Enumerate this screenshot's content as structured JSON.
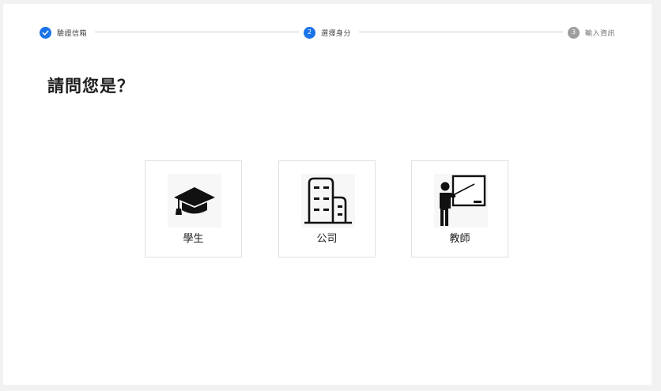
{
  "stepper": {
    "steps": [
      {
        "number": "",
        "label": "驗證信箱",
        "state": "done"
      },
      {
        "number": "2",
        "label": "選擇身分",
        "state": "active"
      },
      {
        "number": "3",
        "label": "輸入資訊",
        "state": "pending"
      }
    ]
  },
  "main": {
    "title": "請問您是？",
    "options": [
      {
        "label": "學生",
        "icon": "graduation-cap-icon"
      },
      {
        "label": "公司",
        "icon": "building-icon"
      },
      {
        "label": "教師",
        "icon": "teacher-icon"
      }
    ]
  },
  "colors": {
    "accent": "#1a73e8",
    "pending": "#9e9e9e"
  }
}
